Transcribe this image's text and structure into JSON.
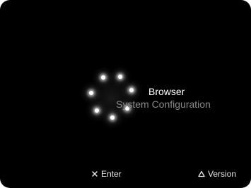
{
  "menu": {
    "items": [
      {
        "label": "Browser",
        "selected": true
      },
      {
        "label": "System Configuration",
        "selected": false
      }
    ]
  },
  "footer": {
    "enter": {
      "icon": "cross-button-icon",
      "label": "Enter"
    },
    "version": {
      "icon": "triangle-button-icon",
      "label": "Version"
    }
  },
  "colors": {
    "background": "#000000",
    "selected_text": "#ffffff",
    "unselected_text": "#8a8a8a",
    "footer_text": "#e6e6e6"
  },
  "decor": {
    "orbit_icon": "clock-orbit-icon"
  }
}
